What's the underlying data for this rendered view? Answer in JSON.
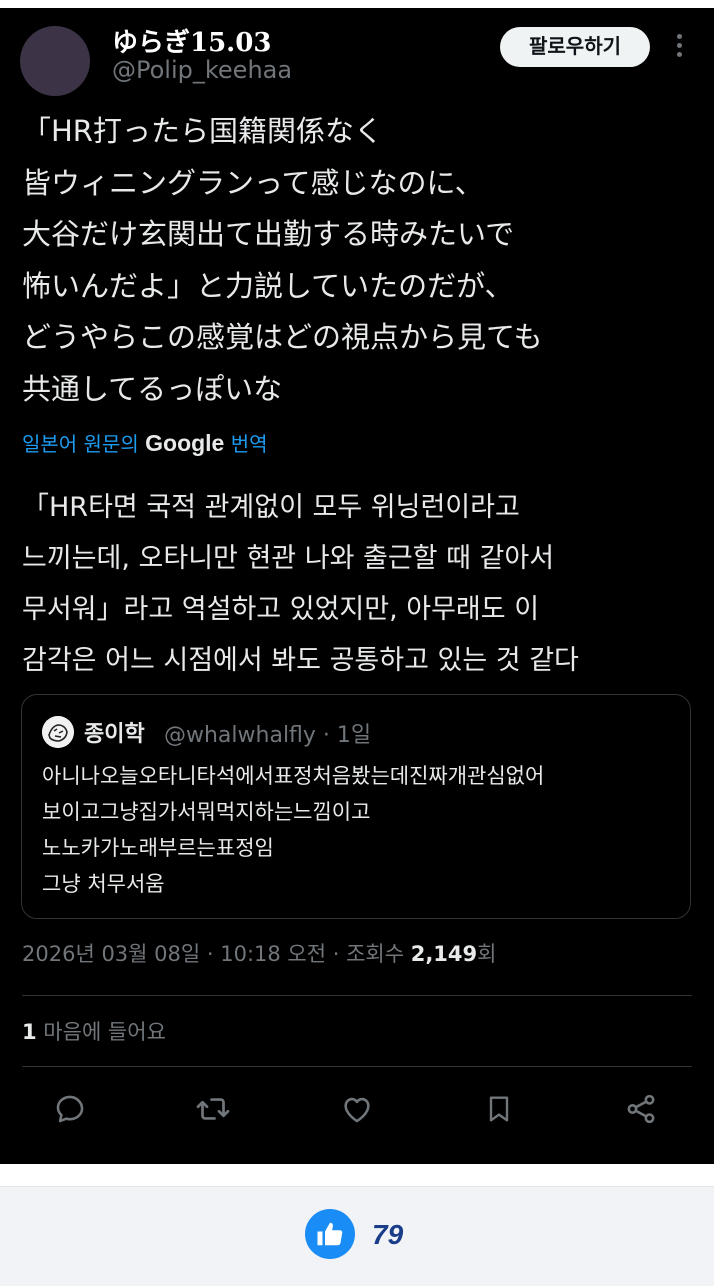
{
  "tweet": {
    "display_name": "ゆらぎ15.03",
    "handle": "@Polip_keehaa",
    "follow_label": "팔로우하기",
    "text_lines": [
      "「HR打ったら国籍関係なく",
      "皆ウィニングランって感じなのに、",
      "大谷だけ玄関出て出勤する時みたいで",
      "怖いんだよ」と力説していたのだが、",
      "どうやらこの感覚はどの視点から見ても",
      "共通してるっぽいな"
    ],
    "translation": {
      "prefix": "일본어 원문의",
      "provider": "Google",
      "suffix": "번역"
    },
    "translated_lines": [
      "「HR타면 국적 관계없이 모두 위닝런이라고",
      "느끼는데, 오타니만 현관 나와 출근할 때 같아서",
      "무서워」라고 역설하고 있었지만, 아무래도 이",
      "감각은 어느 시점에서 봐도 공통하고 있는 것 같다"
    ],
    "quote": {
      "name": "종이학",
      "handle_time": "@whalwhalfly · 1일",
      "lines": [
        "아니나오늘오타니타석에서표정처음봤는데진짜개관심없어",
        "보이고그냥집가서뭐먹지하는느낌이고",
        "노노카가노래부르는표정임",
        "그냥 처무서움"
      ]
    },
    "meta": {
      "date_time": "2026년 03월 08일 · 10:18 오전 · 조회수 ",
      "views": "2,149",
      "views_suffix": "회"
    },
    "likes": {
      "count": "1",
      "label": " 마음에 들어요"
    },
    "actions": [
      "reply-icon",
      "retweet-icon",
      "heart-icon",
      "bookmark-icon",
      "share-icon"
    ]
  },
  "bottom_bar": {
    "like_icon": "thumbs-up-icon",
    "like_count": "79"
  },
  "colors": {
    "tweet_bg": "#000000",
    "text": "#e7e9ea",
    "muted": "#71767b",
    "link": "#1d9bf0",
    "like_blue": "#1a8cf5"
  }
}
